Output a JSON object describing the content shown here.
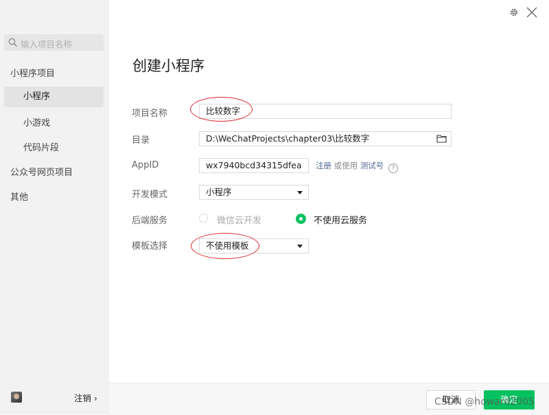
{
  "sidebar": {
    "search_placeholder": "输入项目名称",
    "items": [
      {
        "label": "小程序项目"
      },
      {
        "label": "小程序"
      },
      {
        "label": "小游戏"
      },
      {
        "label": "代码片段"
      },
      {
        "label": "公众号网页项目"
      },
      {
        "label": "其他"
      }
    ],
    "logout_label": "注销"
  },
  "dialog": {
    "title": "创建小程序",
    "fields": {
      "project_name": {
        "label": "项目名称",
        "value": "比较数字"
      },
      "directory": {
        "label": "目录",
        "value": "D:\\WeChatProjects\\chapter03\\比较数字"
      },
      "appid": {
        "label": "AppID",
        "value": "wx7940bcd34315dfea"
      },
      "dev_mode": {
        "label": "开发模式",
        "value": "小程序"
      },
      "backend": {
        "label": "后端服务",
        "option_cloud": "微信云开发",
        "option_none": "不使用云服务"
      },
      "template": {
        "label": "模板选择",
        "value": "不使用模板"
      }
    },
    "links": {
      "register": "注册",
      "or_use": "或使用",
      "test_account": "测试号",
      "help": "?"
    },
    "buttons": {
      "cancel": "取消",
      "confirm": "确定"
    }
  },
  "watermark": "CSDN @howard2005",
  "colors": {
    "accent": "#07c160",
    "annotation": "#d9262b",
    "sidebar_bg": "#f2f2f2"
  }
}
